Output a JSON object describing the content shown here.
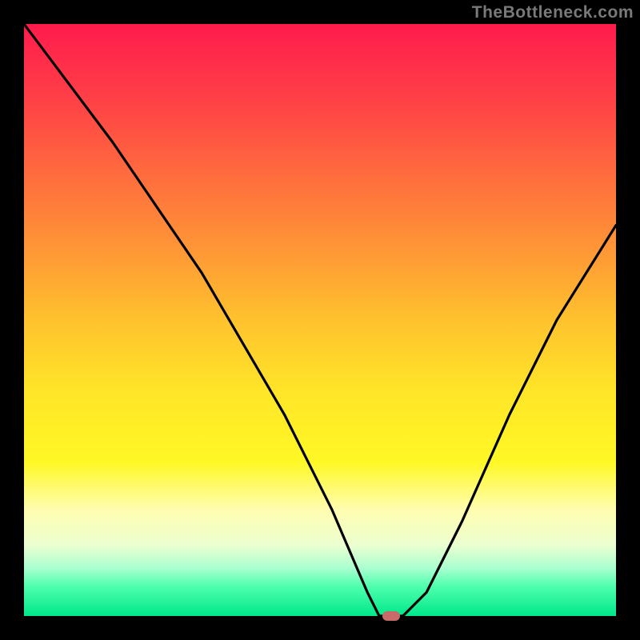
{
  "attribution": "TheBottleneck.com",
  "chart_data": {
    "type": "line",
    "title": "",
    "xlabel": "",
    "ylabel": "",
    "xlim": [
      0,
      100
    ],
    "ylim": [
      0,
      100
    ],
    "series": [
      {
        "name": "curve",
        "x": [
          0,
          15,
          30,
          44,
          52,
          58,
          60,
          64,
          68,
          74,
          82,
          90,
          100
        ],
        "values": [
          100,
          80,
          58,
          34,
          18,
          4,
          0,
          0,
          4,
          16,
          34,
          50,
          66
        ]
      }
    ],
    "marker": {
      "x": 62,
      "y": 0
    },
    "gradient_stops": [
      {
        "pos": 0,
        "color": "#ff1b4c"
      },
      {
        "pos": 50,
        "color": "#ffc22e"
      },
      {
        "pos": 82,
        "color": "#fffdb0"
      },
      {
        "pos": 100,
        "color": "#00e88a"
      }
    ]
  }
}
